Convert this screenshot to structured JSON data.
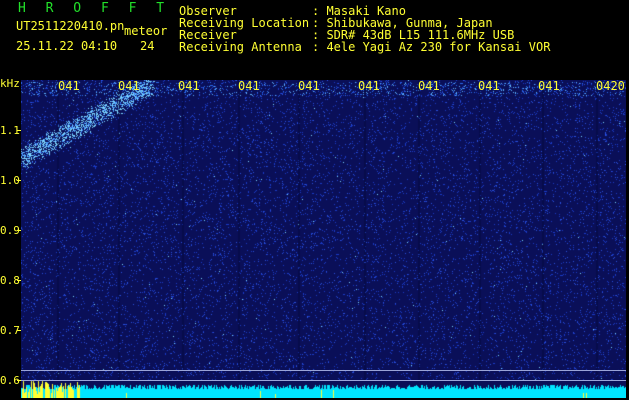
{
  "header": {
    "app_title": "H R O F F T",
    "file_name": "UT2511220410.pn",
    "mode": "meteor",
    "datetime": "25.11.22 04:10",
    "count": "24"
  },
  "info": [
    {
      "label": "Observer",
      "value": ": Masaki Kano"
    },
    {
      "label": "Receiving Location",
      "value": ": Shibukawa, Gunma, Japan"
    },
    {
      "label": "Receiver",
      "value": ": SDR# 43dB L15 111.6MHz USB"
    },
    {
      "label": "Receiving Antenna",
      "value": ": 4ele Yagi Az 230 for Kansai VOR"
    }
  ],
  "plot": {
    "y_unit": "kHz",
    "y_ticks": [
      "1.1",
      "1.0",
      "0.9",
      "0.8",
      "0.7",
      "0.6"
    ],
    "x_ticks": [
      "041",
      "041",
      "041",
      "041",
      "041",
      "041",
      "041",
      "041",
      "041",
      "0420"
    ],
    "colors": {
      "background": "#0a0f58",
      "noise_dim": "#1a3cc8",
      "noise_bright": "#7fd8ff",
      "baseline": "#00e5ff",
      "spikes": "#ffff33",
      "labels": "#ffff33"
    }
  }
}
